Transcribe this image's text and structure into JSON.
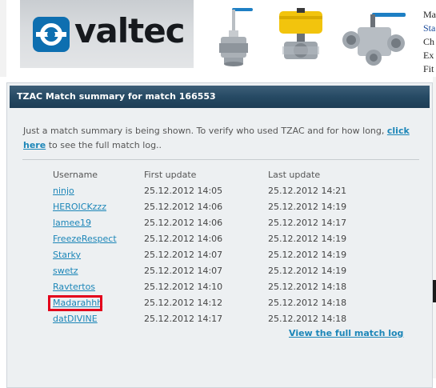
{
  "banner": {
    "logo_text": "valtec",
    "products": [
      "ball-valve-extended-stem",
      "pneumatic-actuated-ball-valve",
      "three-way-ball-valve"
    ],
    "side_text": [
      "Ma",
      "Sta",
      "Ch",
      "Ex",
      "Fit"
    ]
  },
  "panel": {
    "title": "TZAC Match summary for match 166553",
    "notice_before": "Just a match summary is being shown. To verify who used TZAC and for how long,",
    "notice_link": "click here",
    "notice_after": "to see the full match log..",
    "columns": {
      "username": "Username",
      "first_update": "First update",
      "last_update": "Last update"
    },
    "rows": [
      {
        "username": "ninjo",
        "first": "25.12.2012 14:05",
        "last": "25.12.2012 14:21"
      },
      {
        "username": "HEROICKzzz",
        "first": "25.12.2012 14:06",
        "last": "25.12.2012 14:19"
      },
      {
        "username": "lamee19",
        "first": "25.12.2012 14:06",
        "last": "25.12.2012 14:17"
      },
      {
        "username": "FreezeRespect",
        "first": "25.12.2012 14:06",
        "last": "25.12.2012 14:19"
      },
      {
        "username": "Starky",
        "first": "25.12.2012 14:07",
        "last": "25.12.2012 14:19"
      },
      {
        "username": "swetz",
        "first": "25.12.2012 14:07",
        "last": "25.12.2012 14:19"
      },
      {
        "username": "Ravtertos",
        "first": "25.12.2012 14:10",
        "last": "25.12.2012 14:18"
      },
      {
        "username": "Madarahhh",
        "first": "25.12.2012 14:12",
        "last": "25.12.2012 14:18"
      },
      {
        "username": "datDIVINE",
        "first": "25.12.2012 14:17",
        "last": "25.12.2012 14:18"
      }
    ],
    "highlighted_user": "Madarahhh",
    "full_log_link": "View the full match log"
  },
  "colors": {
    "header_bg": "#264a64",
    "link": "#1c86b8",
    "highlight_border": "#e3001b",
    "panel_bg": "#edf0f2"
  }
}
